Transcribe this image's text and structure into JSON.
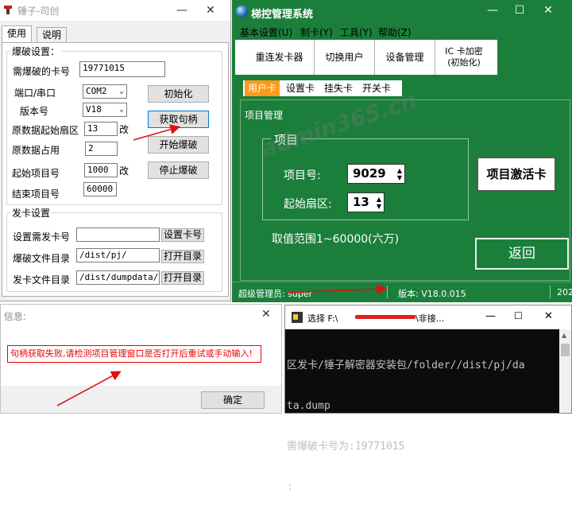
{
  "hammer": {
    "title": "锤子-司创",
    "tabs": [
      "使用",
      "说明"
    ],
    "group_crack": "爆破设置：",
    "card_label": "需爆破的卡号",
    "card_value": "19771015",
    "port_label": "端口/串口",
    "port_value": "COM2",
    "version_label": "版本号",
    "version_value": "V18",
    "start_sector_label": "原数据起始扇区",
    "start_sector_value": "13",
    "usage_label": "原数据占用",
    "usage_value": "2",
    "start_item_label": "起始项目号",
    "start_item_value": "1000",
    "end_item_label": "结束项目号",
    "end_item_value": "60000",
    "change_label": "改",
    "btn_init": "初始化",
    "btn_get_handle": "获取句柄",
    "btn_start": "开始爆破",
    "btn_stop": "停止爆破",
    "group_issue": "发卡设置",
    "issue_card_label": "设置需发卡号",
    "issue_card_value": "",
    "btn_set_card": "设置卡号",
    "crack_dir_label": "爆破文件目录",
    "crack_dir_value": "/dist/pj/",
    "btn_open_dir": "打开目录",
    "issue_dir_label": "发卡文件目录",
    "issue_dir_value": "/dist/dumpdata/",
    "btn_open_dir2": "打开目录"
  },
  "elevator": {
    "title": "梯控管理系统",
    "menu": [
      "基本设置(U)",
      "制卡(Y)",
      "工具(Y)",
      "帮助(Z)"
    ],
    "toolbar": [
      "重连发卡器",
      "切换用户",
      "设备管理"
    ],
    "toolbar_ic_line1": "IC 卡加密",
    "toolbar_ic_line2": "(初始化)",
    "tabs": [
      "用户卡",
      "设置卡",
      "挂失卡",
      "开关卡"
    ],
    "section": "项目管理",
    "group": "项目",
    "item_no_label": "项目号:",
    "item_no_value": "9029",
    "sector_label": "起始扇区:",
    "sector_value": "13",
    "range_text": "取值范围1~60000(六万)",
    "btn_activate": "项目激活卡",
    "btn_back": "返回",
    "status_admin": "超级管理员: super",
    "status_version": "版本: V18.0.015",
    "status_date": "202"
  },
  "msgbox": {
    "title": "信息:",
    "message": "句柄获取失败,请检测项目管理窗口是否打开后重试或手动输入!",
    "btn_ok": "确定"
  },
  "console": {
    "title_prefix": "选择 F:\\",
    "title_suffix": "\\非接...",
    "line1": "区发卡/锤子解密器安装包/folder//dist/pj/da",
    "line2": "ta.dump",
    "line3": "需爆破卡号为:19771015",
    "line4": ":"
  },
  "watermark": "admin365.cn",
  "colors": {
    "app_green": "#1b7f3b",
    "tab_orange": "#ff9a1a",
    "error_red": "#e00000"
  }
}
